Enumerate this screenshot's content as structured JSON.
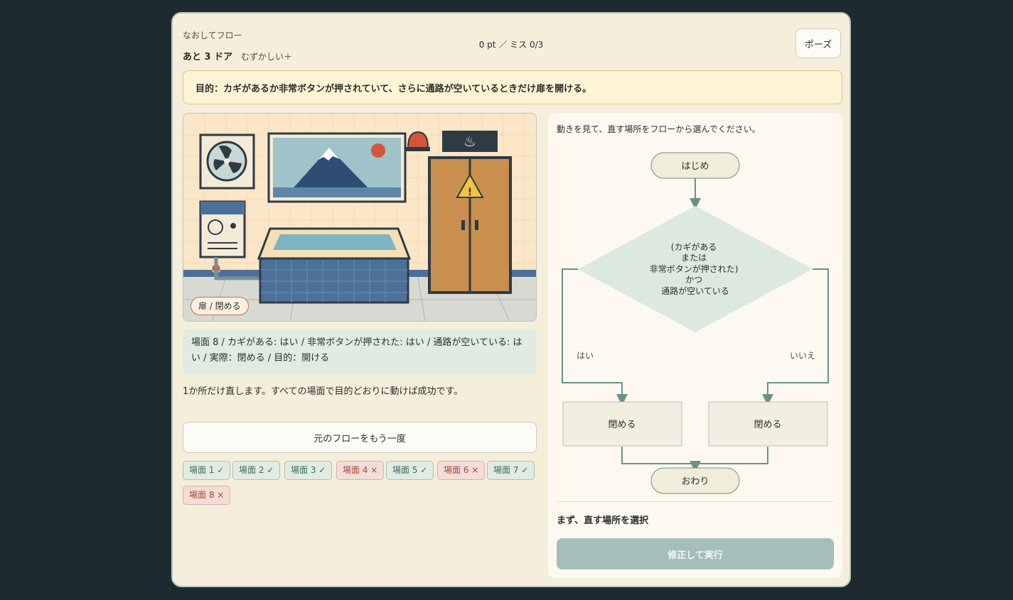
{
  "header": {
    "app_title": "なおしてフロー",
    "remaining": "あと 3 ドア",
    "difficulty": "むずかしい＋",
    "score": "0 pt ／ ミス 0/3",
    "pause_label": "ポーズ"
  },
  "goal": "目的：カギがあるか非常ボタンが押されていて、さらに通路が空いているときだけ扉を開ける。",
  "scene": {
    "door_state": "扉 / 閉める",
    "info": "場面 8 / カギがある: はい / 非常ボタンが押された: はい / 通路が空いている: はい / 実際：閉める / 目的：開ける"
  },
  "instruction": "1か所だけ直します。すべての場面で目的どおりに動けば成功です。",
  "replay_label": "元のフローをもう一度",
  "results": [
    {
      "label": "場面 1 ✓",
      "status": "ok"
    },
    {
      "label": "場面 2 ✓",
      "status": "ok"
    },
    {
      "label": "場面 3 ✓",
      "status": "ok"
    },
    {
      "label": "場面 4 ×",
      "status": "ng"
    },
    {
      "label": "場面 5 ✓",
      "status": "ok"
    },
    {
      "label": "場面 6 ×",
      "status": "ng"
    },
    {
      "label": "場面 7 ✓",
      "status": "ok"
    },
    {
      "label": "場面 8 ×",
      "status": "ng"
    }
  ],
  "flow": {
    "instruction": "動きを見て、直す場所をフローから選んでください。",
    "start": "はじめ",
    "condition": [
      "(カギがある",
      "または",
      "非常ボタンが押された)",
      "かつ",
      "通路が空いている"
    ],
    "yes_label": "はい",
    "no_label": "いいえ",
    "yes_action": "閉める",
    "no_action": "閉める",
    "end": "おわり",
    "selection_status": "まず、直す場所を選択",
    "run_label": "修正して実行"
  },
  "colors": {
    "background": "#1d2b30",
    "panel": "#f4eedb",
    "goal_bg": "#fcf4d4",
    "ok": "#3d6b5a",
    "ng": "#a24a3c",
    "flow_line": "#6b8f89",
    "run_button": "#a5bebc"
  }
}
